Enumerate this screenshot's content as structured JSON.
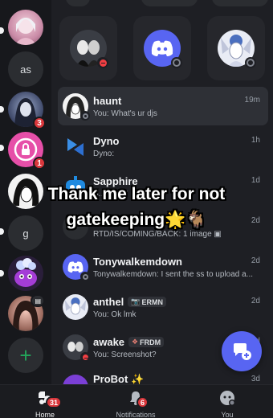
{
  "servers": [
    {
      "name": "anime-girl-server",
      "badge": ""
    },
    {
      "name": "as-server",
      "initials": "as",
      "badge": ""
    },
    {
      "name": "dark-hair-server",
      "badge": "3"
    },
    {
      "name": "pink-lock-server",
      "badge": "1"
    },
    {
      "name": "manga-server",
      "badge": ""
    },
    {
      "name": "g-server",
      "initials": "g",
      "badge": ""
    },
    {
      "name": "purple-creature-server",
      "badge": ""
    },
    {
      "name": "selfie-server",
      "badge": ""
    }
  ],
  "add_server_label": "+",
  "overlay": {
    "line1": "Thank me later for not",
    "line2": "gatekeeping",
    "emoji": "🌟🐐"
  },
  "dms": [
    {
      "name": "haunt",
      "preview": "You: What's ur djs",
      "time": "19m",
      "tag": "",
      "tag_icon": ""
    },
    {
      "name": "Dyno",
      "preview": "Dyno:",
      "time": "1h",
      "tag": "",
      "tag_icon": ""
    },
    {
      "name": "Sapphire",
      "preview": "S... ...cky!",
      "time": "1d",
      "tag": "",
      "tag_icon": ""
    },
    {
      "name": "",
      "preview": "RTD/IS/COMING/BACK: 1 image",
      "time": "2d",
      "tag": "",
      "tag_icon": ""
    },
    {
      "name": "Tonywalkemdown",
      "preview": "Tonywalkemdown: I sent the ss to upload a...",
      "time": "2d",
      "tag": "",
      "tag_icon": ""
    },
    {
      "name": "anthel",
      "preview": "You: Ok lmk",
      "time": "2d",
      "tag": "ERMN",
      "tag_icon": "📷"
    },
    {
      "name": "awake",
      "preview": "You: Screenshot?",
      "time": "2d",
      "tag": "FRDM",
      "tag_icon": "❖"
    },
    {
      "name": "ProBot",
      "preview": "",
      "time": "3d",
      "tag": "",
      "tag_icon": "✨"
    }
  ],
  "tabs": [
    {
      "label": "Home",
      "badge": "31"
    },
    {
      "label": "Notifications",
      "badge": "6"
    },
    {
      "label": "You",
      "badge": ""
    }
  ],
  "colors": {
    "accent": "#5865f2",
    "danger": "#da373c",
    "background": "#1e1f24"
  }
}
